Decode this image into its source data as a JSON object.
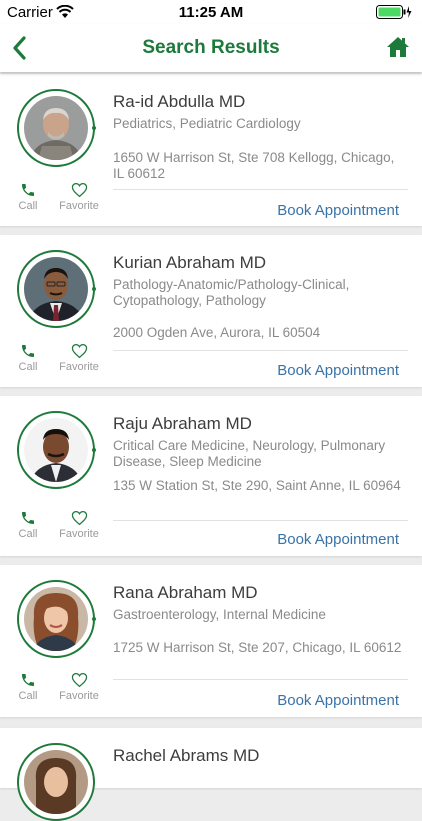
{
  "status_bar": {
    "carrier": "Carrier",
    "time": "11:25 AM"
  },
  "nav": {
    "title": "Search Results",
    "back_icon": "chevron-left-icon",
    "home_icon": "home-icon"
  },
  "colors": {
    "brand_green": "#1e7a3a",
    "link_blue": "#3a73a8"
  },
  "actions": {
    "call": "Call",
    "favorite": "Favorite",
    "book": "Book Appointment"
  },
  "doctors": [
    {
      "name": "Ra-id Abdulla MD",
      "specialty": "Pediatrics, Pediatric Cardiology",
      "address": "1650 W Harrison St, Ste 708 Kellogg, Chicago, IL 60612"
    },
    {
      "name": "Kurian Abraham MD",
      "specialty": "Pathology-Anatomic/Pathology-Clinical, Cytopathology, Pathology",
      "address": "2000 Ogden Ave, Aurora, IL 60504"
    },
    {
      "name": "Raju Abraham MD",
      "specialty": "Critical Care Medicine, Neurology, Pulmonary Disease, Sleep Medicine",
      "address": "135 W Station St, Ste 290, Saint Anne, IL 60964"
    },
    {
      "name": "Rana Abraham MD",
      "specialty": "Gastroenterology, Internal Medicine",
      "address": "1725 W Harrison St, Ste 207, Chicago, IL 60612"
    },
    {
      "name": "Rachel Abrams MD"
    }
  ]
}
